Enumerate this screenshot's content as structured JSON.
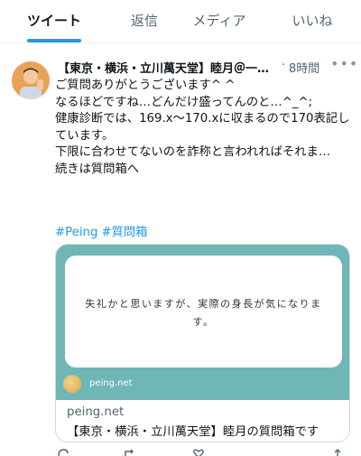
{
  "tabs": [
    {
      "label": "ツイート"
    },
    {
      "label": "返信"
    },
    {
      "label": "メディア"
    },
    {
      "label": "いいね"
    }
  ],
  "tweet": {
    "author_name": "【東京・横浜・立川萬天堂】睦月＠一日…",
    "time": "8時間",
    "more_icon": "more-icon",
    "lines": [
      "ご質問ありがとうございます^ ^",
      "",
      "なるほどですね…どんだけ盛ってんのと…^_^;",
      "健康診断では、169.x〜170.xに収まるので170表記しています。",
      "下限に合わせてないのを詐称と言われればそれま…",
      "",
      "続きは質問箱へ"
    ],
    "hashtags": [
      "#Peing",
      "#質問箱"
    ]
  },
  "card": {
    "question": "失礼かと思いますが、実際の身長が気になります。",
    "brand_small": "peing.net",
    "domain": "peing.net",
    "title": "【東京・横浜・立川萬天堂】睦月の質問箱です"
  },
  "colors": {
    "accent": "#1d9bf0",
    "card_bg": "#6fb7b7",
    "muted": "#536471"
  }
}
